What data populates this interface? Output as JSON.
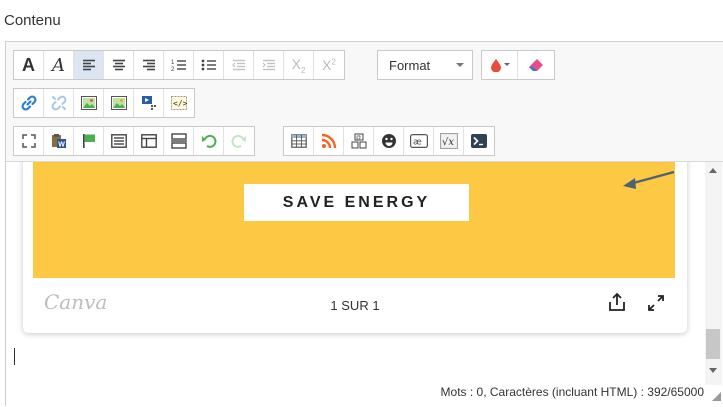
{
  "field": {
    "label": "Contenu"
  },
  "toolbar": {
    "format_label": "Format",
    "text_color": "#e84c3d",
    "accent_color": "#2a7fd4",
    "rows": [
      [
        "bold-a",
        "italic-a",
        "align-left",
        "align-center",
        "align-right",
        "numbered-list",
        "bullet-list",
        "outdent",
        "indent",
        "subscript",
        "superscript",
        "format-select",
        "text-color",
        "eraser"
      ],
      [
        "link",
        "unlink",
        "image",
        "image-edit",
        "video",
        "html-embed"
      ],
      [
        "fullscreen",
        "paste-word",
        "flag",
        "list-box",
        "template",
        "page-break",
        "undo",
        "redo",
        "table",
        "rss",
        "special-chars",
        "emoji",
        "ae",
        "math",
        "code-console"
      ]
    ]
  },
  "content": {
    "banner_color": "#fdc844",
    "banner_button": "SAVE ENERGY",
    "canva_logo": "Canva",
    "page_count": "1 SUR 1"
  },
  "statusbar": {
    "word_count": "Mots : 0, Caractères (incluant HTML) : 392/65000"
  }
}
